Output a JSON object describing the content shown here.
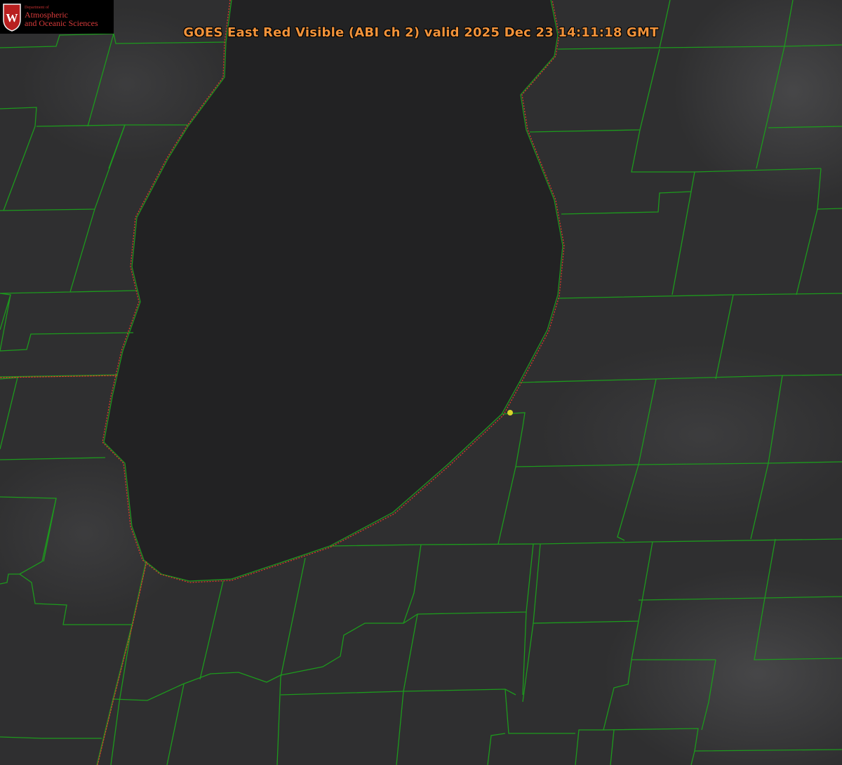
{
  "title": "GOES East Red Visible (ABI ch 2) valid 2025 Dec 23 14:11:18 GMT",
  "logo": {
    "department": "Department of",
    "line1": "Atmospheric",
    "line2": "and Oceanic Sciences",
    "emblem_letter": "W"
  },
  "colors": {
    "county_lines": "#1d9a1d",
    "state_line": "#d83a2a",
    "shoreline": "#d83a2a",
    "lake": "#222223",
    "land": "#2f2f30",
    "marker": "#d9d42b",
    "title": "#f0923a"
  },
  "marker": {
    "name": "station-marker"
  }
}
